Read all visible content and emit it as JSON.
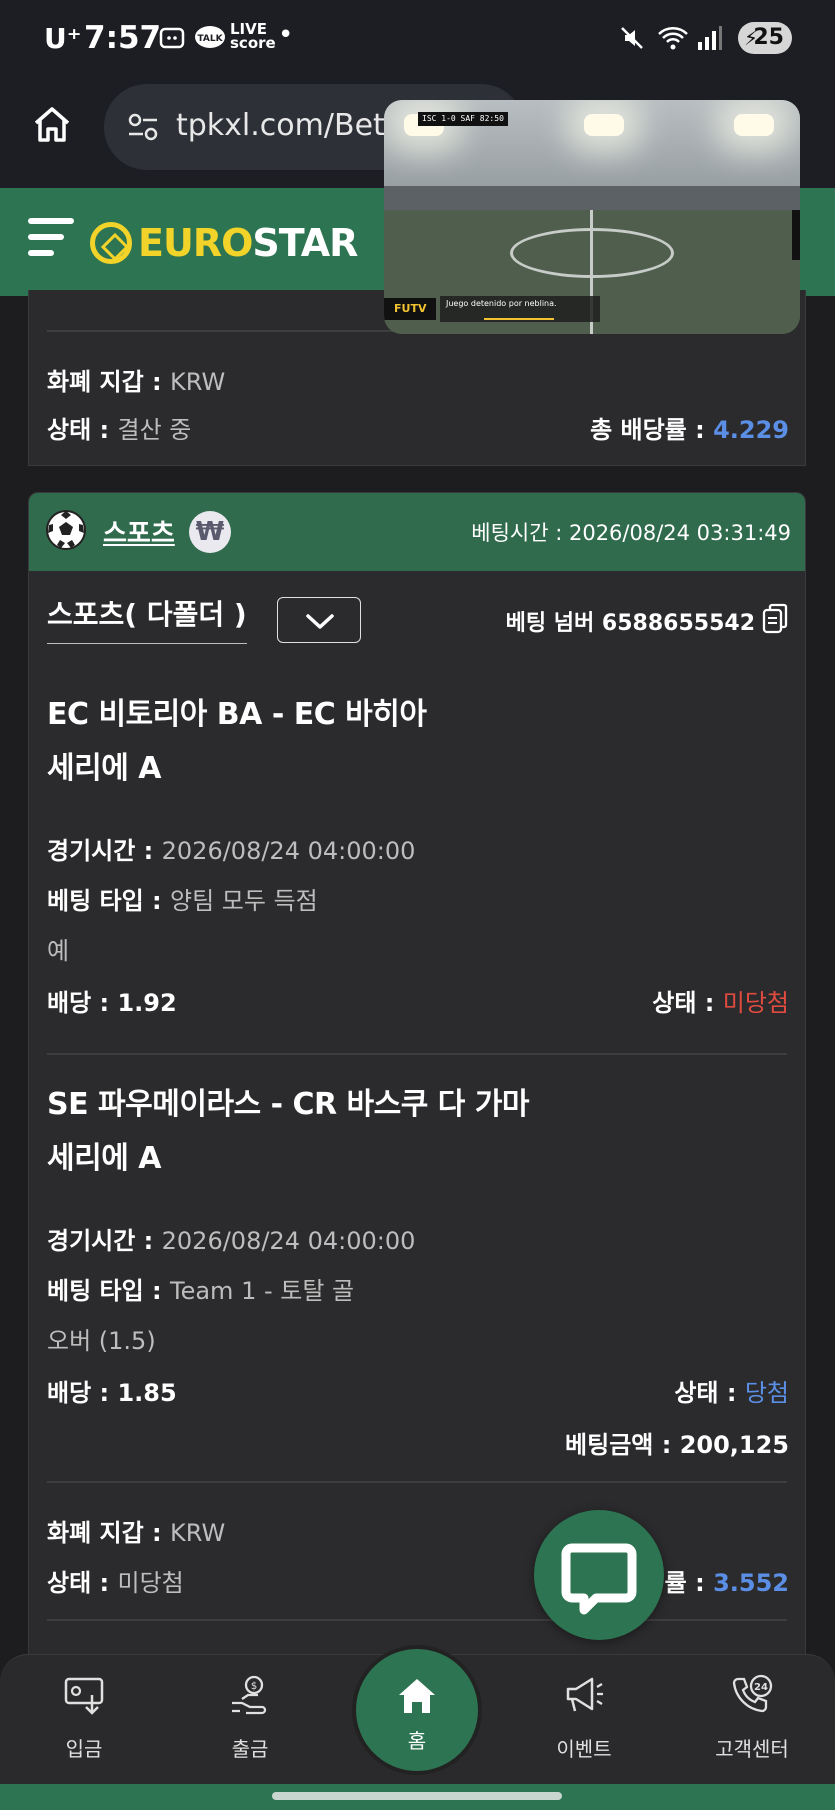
{
  "status_bar": {
    "carrier": "U⁺",
    "time": "7:57",
    "live_line1": "LIVE",
    "live_line2": "score",
    "battery": "25"
  },
  "browser": {
    "url": "tpkxl.com/Bet"
  },
  "header": {
    "logo_part1": "EURO",
    "logo_part2": "STAR"
  },
  "video": {
    "scorebug": "ISC 1-0 SAF 82:50",
    "channel": "FUTV",
    "caption": "Juego detenido por neblina."
  },
  "prev_card": {
    "currency_label": "화폐 지갑 :",
    "currency_value": "KRW",
    "status_label": "상태 :",
    "status_value": "결산 중",
    "total_odds_label": "총 배당률 :",
    "total_odds_value": "4.229"
  },
  "bet_card": {
    "category": "스포츠",
    "currency_symbol": "₩",
    "bet_time_label": "베팅시간 :",
    "bet_time_value": "2026/08/24 03:31:49",
    "tab_title": "스포츠( 다폴더 )",
    "bet_number_label": "베팅 넘버",
    "bet_number_value": "6588655542",
    "selections": [
      {
        "match": "EC 비토리아 BA - EC 바히아",
        "league": "세리에 A",
        "time_label": "경기시간 :",
        "time_value": "2026/08/24 04:00:00",
        "type_label": "베팅 타입 :",
        "type_value": "양팀 모두 득점",
        "pick": "예",
        "odds_label": "배당 :",
        "odds_value": "1.92",
        "status_label": "상태 :",
        "status_value": "미당첨"
      },
      {
        "match": "SE 파우메이라스 - CR 바스쿠 다 가마",
        "league": "세리에 A",
        "time_label": "경기시간 :",
        "time_value": "2026/08/24 04:00:00",
        "type_label": "베팅 타입 :",
        "type_value": "Team 1 - 토탈 골",
        "pick": "오버 (1.5)",
        "odds_label": "배당 :",
        "odds_value": "1.85",
        "status_label": "상태 :",
        "status_value": "당첨"
      }
    ],
    "bet_amount_label": "베팅금액 :",
    "bet_amount_value": "200,125",
    "currency_label": "화폐 지갑 :",
    "currency_value": "KRW",
    "status_label": "상태 :",
    "status_value": "미당첨",
    "total_odds_label": "률 :",
    "total_odds_value": "3.552"
  },
  "bottom_nav": {
    "items": [
      {
        "label": "입금",
        "icon": "deposit-icon"
      },
      {
        "label": "출금",
        "icon": "withdraw-icon"
      },
      {
        "label": "홈",
        "icon": "home-icon"
      },
      {
        "label": "이벤트",
        "icon": "megaphone-icon"
      },
      {
        "label": "고객센터",
        "icon": "support-24-icon"
      }
    ]
  },
  "colors": {
    "brand_green": "#2d7452",
    "logo_yellow": "#f2d32a",
    "win_blue": "#5b8fe6",
    "lose_red": "#e04b40"
  }
}
